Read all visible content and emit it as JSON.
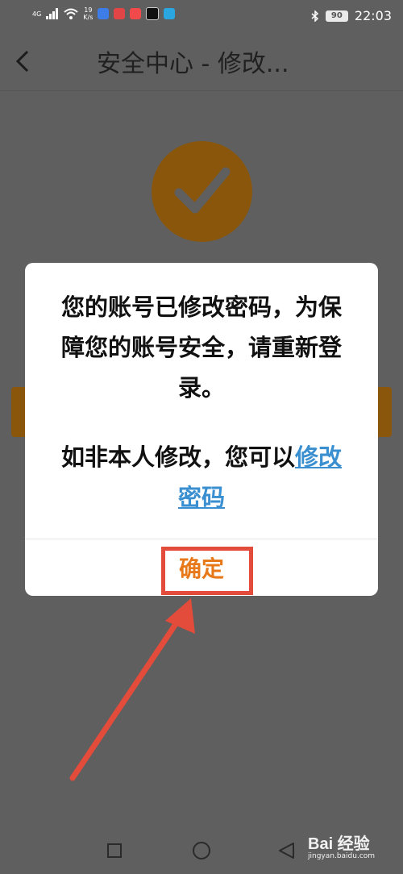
{
  "status_bar": {
    "net_type": "4G",
    "speed_value": "19",
    "speed_unit": "K/s",
    "battery": "90",
    "time": "22:03"
  },
  "nav": {
    "title": "安全中心 - 修改..."
  },
  "dialog": {
    "message_line1": "您的账号已修改密码，为保障您的账号安全，请重新登录。",
    "message_line2_prefix": "如非本人修改，您可以",
    "message_link": "修改密码",
    "confirm_label": "确定"
  },
  "watermark": {
    "brand": "Bai 经验",
    "site": "jingyan.baidu.com"
  },
  "colors": {
    "accent": "#8a560c",
    "confirm": "#e8791a",
    "link": "#3a8fd0",
    "annotation": "#e34b3a"
  }
}
